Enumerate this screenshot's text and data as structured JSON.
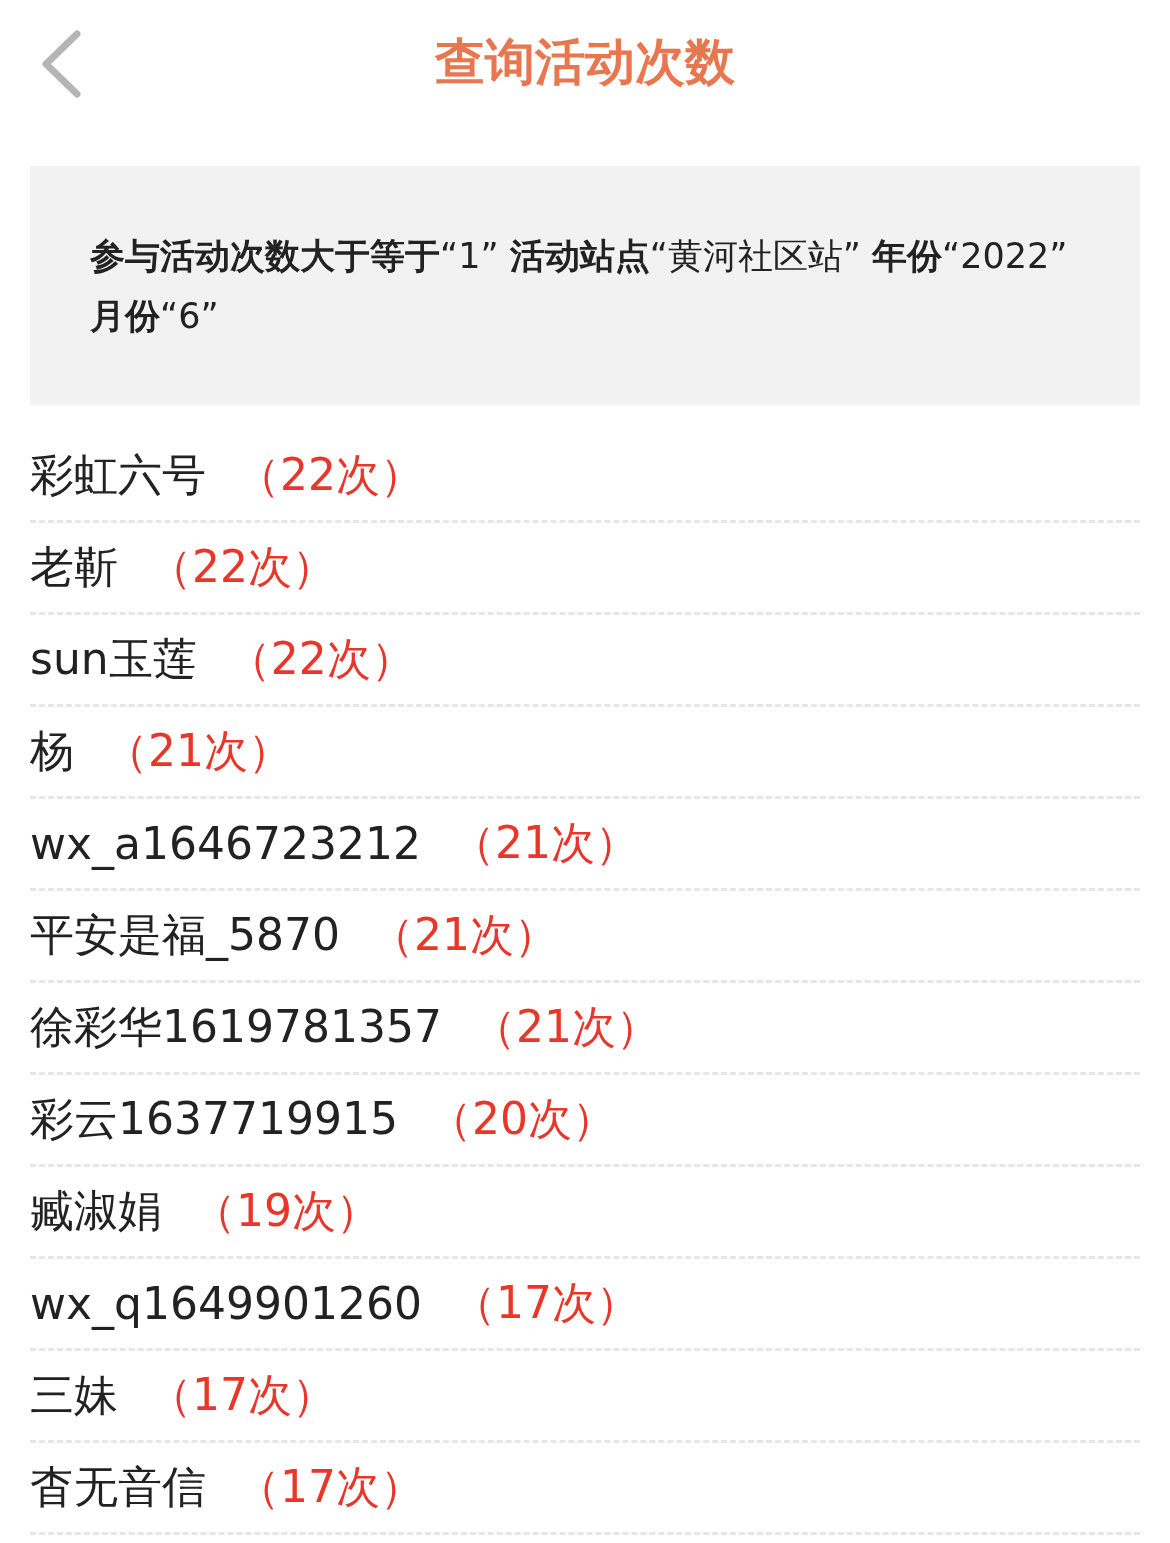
{
  "header": {
    "title": "查询活动次数"
  },
  "summary": "**参与活动次数大于等于**“1” **活动站点**“黄河社区站” **年份**“2022” **月份**“6”",
  "rows": [
    {
      "name": "彩虹六号",
      "count": "（22次）"
    },
    {
      "name": "老靳",
      "count": "（22次）"
    },
    {
      "name": "sun玉莲",
      "count": "（22次）"
    },
    {
      "name": "杨",
      "count": "（21次）"
    },
    {
      "name": "wx_a1646723212",
      "count": "（21次）"
    },
    {
      "name": "平安是福_5870",
      "count": "（21次）"
    },
    {
      "name": "徐彩华1619781357",
      "count": "（21次）"
    },
    {
      "name": "彩云1637719915",
      "count": "（20次）"
    },
    {
      "name": "臧淑娟",
      "count": "（19次）"
    },
    {
      "name": "wx_q1649901260",
      "count": "（17次）"
    },
    {
      "name": "三妹",
      "count": "（17次）"
    },
    {
      "name": "杳无音信",
      "count": "（17次）"
    }
  ]
}
